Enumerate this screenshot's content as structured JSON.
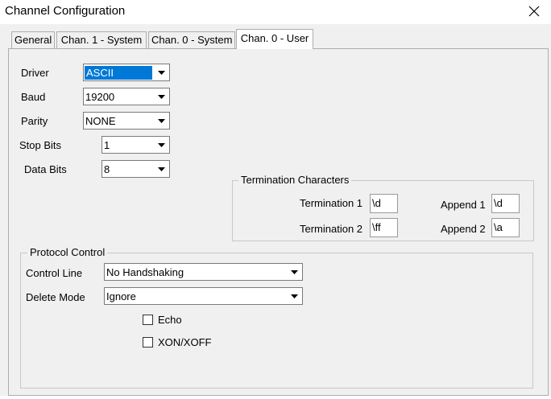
{
  "window": {
    "title": "Channel Configuration"
  },
  "tabs": [
    {
      "label": "General"
    },
    {
      "label": "Chan. 1 - System"
    },
    {
      "label": "Chan. 0 - System"
    },
    {
      "label": "Chan. 0 - User"
    }
  ],
  "serial": {
    "driver_label": "Driver",
    "driver_value": "ASCII",
    "baud_label": "Baud",
    "baud_value": "19200",
    "parity_label": "Parity",
    "parity_value": "NONE",
    "stop_bits_label": "Stop Bits",
    "stop_bits_value": "1",
    "data_bits_label": "Data Bits",
    "data_bits_value": "8"
  },
  "termination": {
    "title": "Termination Characters",
    "term1_label": "Termination 1",
    "term1_value": "\\d",
    "append1_label": "Append 1",
    "append1_value": "\\d",
    "term2_label": "Termination 2",
    "term2_value": "\\ff",
    "append2_label": "Append 2",
    "append2_value": "\\a"
  },
  "protocol": {
    "title": "Protocol Control",
    "control_line_label": "Control Line",
    "control_line_value": "No Handshaking",
    "delete_mode_label": "Delete Mode",
    "delete_mode_value": "Ignore",
    "echo_label": "Echo",
    "echo_checked": false,
    "xon_label": "XON/XOFF",
    "xon_checked": false
  },
  "icons": {
    "close": "close-icon",
    "dropdown": "chevron-down-icon",
    "checkbox": "checkbox-icon"
  }
}
